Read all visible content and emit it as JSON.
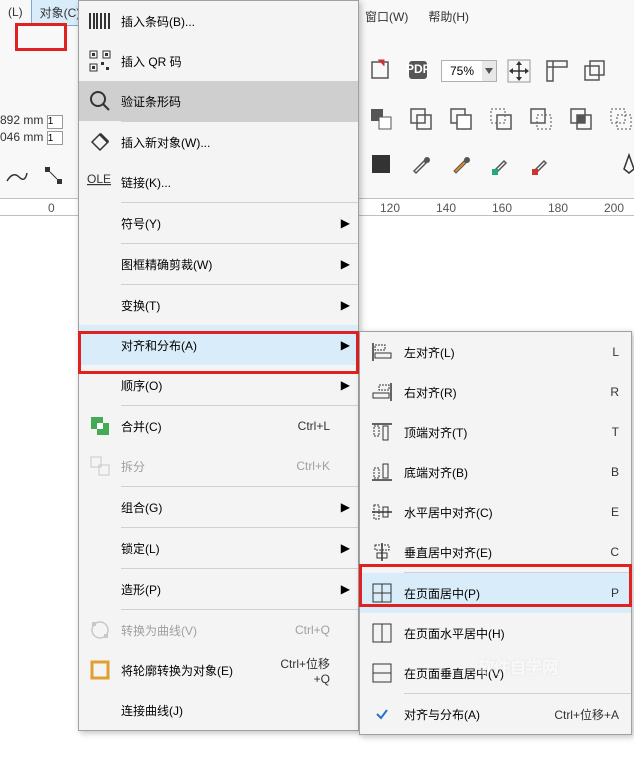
{
  "menubar": {
    "left_item": "(L)",
    "object_menu": "对象(C)",
    "window_menu": "窗口(W)",
    "help_menu": "帮助(H)"
  },
  "toolbar": {
    "zoom_value": "75%"
  },
  "dims": {
    "w": "892 mm",
    "h": "046 mm",
    "v1": "1",
    "v2": "1"
  },
  "ruler": {
    "t0": "0",
    "t120": "120",
    "t140": "140",
    "t160": "160",
    "t180": "180",
    "t200": "200"
  },
  "menu1": {
    "insert_barcode": "插入条码(B)...",
    "insert_qr": "插入 QR 码",
    "verify_barcode": "验证条形码",
    "insert_new_object": "插入新对象(W)...",
    "links": "链接(K)...",
    "symbol": "符号(Y)",
    "powerclip": "图框精确剪裁(W)",
    "transform": "变换(T)",
    "align_distribute": "对齐和分布(A)",
    "order": "顺序(O)",
    "combine": "合并(C)",
    "combine_sc": "Ctrl+L",
    "break": "拆分",
    "break_sc": "Ctrl+K",
    "group": "组合(G)",
    "lock": "锁定(L)",
    "shape": "造形(P)",
    "to_curves": "转换为曲线(V)",
    "to_curves_sc": "Ctrl+Q",
    "outline_to_obj": "将轮廓转换为对象(E)",
    "outline_to_obj_sc": "Ctrl+位移+Q",
    "join_curves": "连接曲线(J)"
  },
  "menu2": {
    "align_left": "左对齐(L)",
    "align_left_sc": "L",
    "align_right": "右对齐(R)",
    "align_right_sc": "R",
    "align_top": "顶端对齐(T)",
    "align_top_sc": "T",
    "align_bottom": "底端对齐(B)",
    "align_bottom_sc": "B",
    "center_h": "水平居中对齐(C)",
    "center_h_sc": "E",
    "center_v": "垂直居中对齐(E)",
    "center_v_sc": "C",
    "center_page": "在页面居中(P)",
    "center_page_sc": "P",
    "center_page_h": "在页面水平居中(H)",
    "center_page_v": "在页面垂直居中(V)",
    "align_dist": "对齐与分布(A)",
    "align_dist_sc": "Ctrl+位移+A"
  },
  "watermark": "软件自学网"
}
